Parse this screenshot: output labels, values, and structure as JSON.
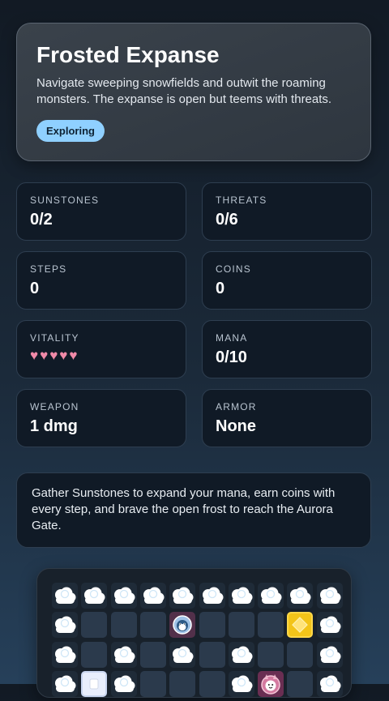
{
  "header": {
    "title": "Frosted Expanse",
    "description": "Navigate sweeping snowfields and outwit the roaming monsters. The expanse is open but teems with threats.",
    "status": "Exploring"
  },
  "stats": {
    "sunstones": {
      "label": "SUNSTONES",
      "value": "0/2"
    },
    "threats": {
      "label": "THREATS",
      "value": "0/6"
    },
    "steps": {
      "label": "STEPS",
      "value": "0"
    },
    "coins": {
      "label": "COINS",
      "value": "0"
    },
    "vitality": {
      "label": "VITALITY",
      "hearts": "♥♥♥♥♥",
      "count": 5
    },
    "mana": {
      "label": "MANA",
      "value": "0/10"
    },
    "weapon": {
      "label": "WEAPON",
      "value": "1 dmg"
    },
    "armor": {
      "label": "ARMOR",
      "value": "None"
    }
  },
  "info": {
    "text": "Gather Sunstones to expand your mana, earn coins with every step, and brave the open frost to reach the Aurora Gate."
  },
  "board": {
    "rows": [
      [
        "snow",
        "snow",
        "snow",
        "snow",
        "snow",
        "snow",
        "snow",
        "snow",
        "snow",
        "snow"
      ],
      [
        "snow",
        "ice",
        "ice",
        "ice",
        "monster-penguin",
        "ice",
        "ice",
        "ice",
        "sunstone",
        "snow"
      ],
      [
        "snow",
        "ice",
        "snow",
        "ice",
        "snow",
        "ice",
        "snow",
        "ice",
        "ice",
        "snow"
      ],
      [
        "snow",
        "player",
        "snow",
        "ice",
        "ice",
        "ice",
        "snow",
        "monster-cat",
        "ice",
        "snow"
      ]
    ]
  },
  "colors": {
    "badge": "#8fd0ff",
    "hearts": "#f08aa8",
    "sunstone": "#f3c419",
    "monster_tile": "#52304a"
  }
}
